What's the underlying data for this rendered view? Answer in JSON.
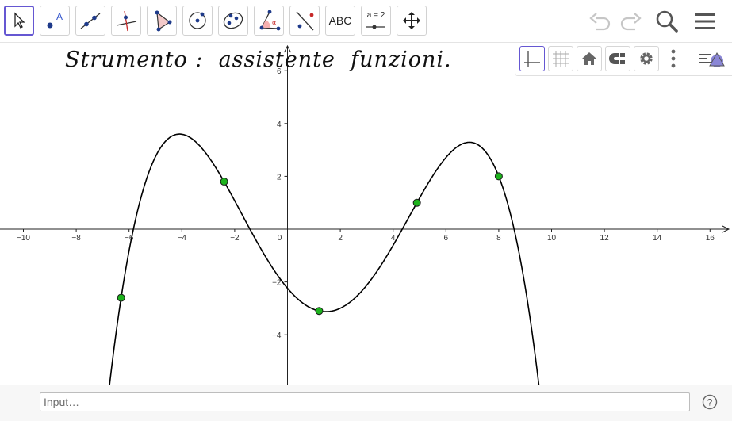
{
  "toolbar": {
    "tools": [
      {
        "name": "move",
        "icon": "cursor-arrow-icon"
      },
      {
        "name": "point",
        "icon": "point-icon",
        "label": "A"
      },
      {
        "name": "line",
        "icon": "line-icon"
      },
      {
        "name": "perpendicular-line",
        "icon": "perpendicular-line-icon"
      },
      {
        "name": "polygon",
        "icon": "polygon-icon"
      },
      {
        "name": "circle-center-point",
        "icon": "circle-icon"
      },
      {
        "name": "ellipse",
        "icon": "ellipse-icon"
      },
      {
        "name": "angle",
        "icon": "angle-icon"
      },
      {
        "name": "reflect-about-line",
        "icon": "reflect-line-icon"
      },
      {
        "name": "text",
        "icon": "text-tool-icon",
        "label": "ABC"
      },
      {
        "name": "slider",
        "icon": "slider-icon",
        "label": "a = 2"
      },
      {
        "name": "move-graphics-view",
        "icon": "move-graphics-icon"
      }
    ],
    "right": [
      "undo-icon",
      "redo-icon",
      "search-icon",
      "menu-icon"
    ]
  },
  "title": "Strumento :  assistente  funzioni.",
  "style_bar": [
    "axes-icon",
    "grid-icon",
    "home-icon",
    "point-capturing-icon",
    "gear-icon",
    "more-vert-icon",
    "toggle-style-bar-icon"
  ],
  "input": {
    "placeholder": "Input…",
    "value": ""
  },
  "help_icon": "help-icon",
  "chart_data": {
    "type": "scatter",
    "x_ticks": [
      -10,
      -8,
      -6,
      -4,
      -2,
      0,
      2,
      4,
      6,
      8,
      10,
      12,
      14,
      16
    ],
    "y_ticks": [
      -4,
      -2,
      2,
      4,
      6
    ],
    "xlim": [
      -10.9,
      16.8
    ],
    "ylim": [
      -5.9,
      6.1
    ],
    "points": [
      {
        "x": -6.3,
        "y": -2.6
      },
      {
        "x": -2.4,
        "y": 1.8
      },
      {
        "x": 1.2,
        "y": -3.1
      },
      {
        "x": 4.9,
        "y": 1.0
      },
      {
        "x": 8.0,
        "y": 2.0
      }
    ],
    "curve": "quartic through the five points",
    "point_color": "#1db31d",
    "curve_color": "#000000"
  }
}
